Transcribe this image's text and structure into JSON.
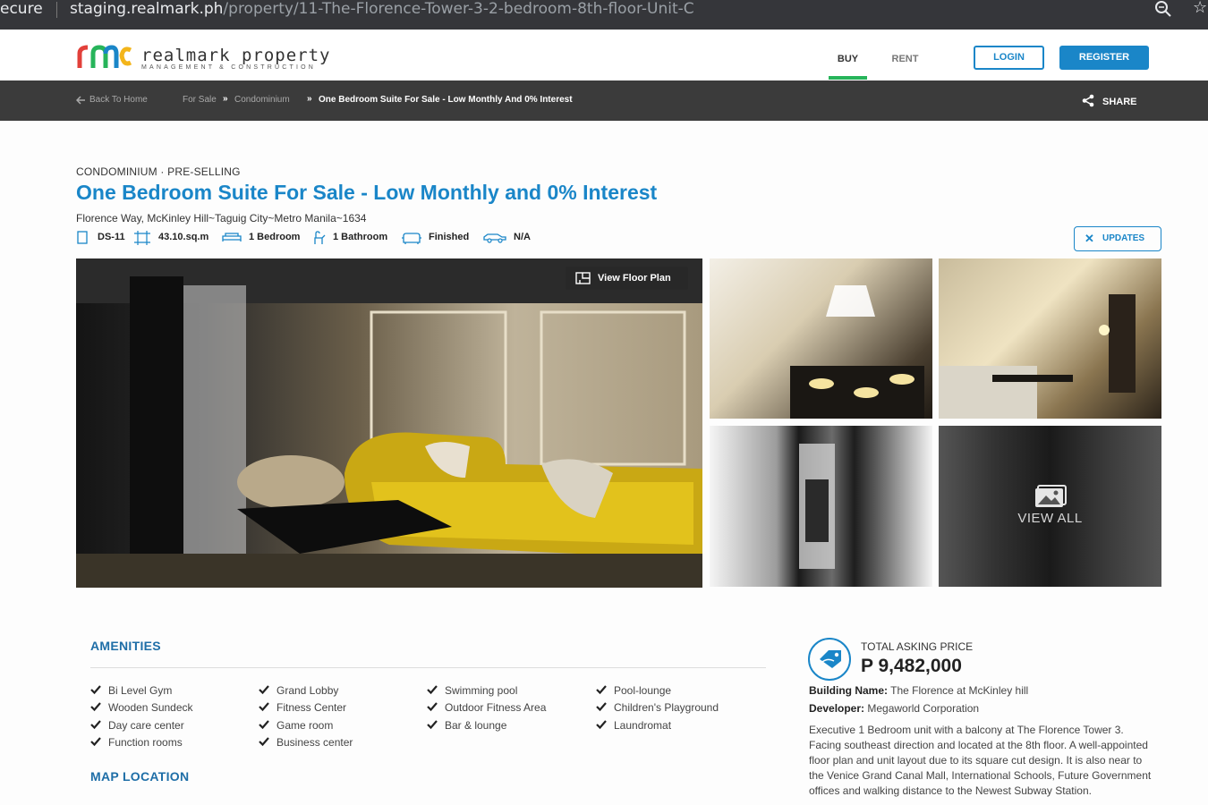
{
  "browser": {
    "security": "ecure",
    "url_host": "staging.realmark.ph",
    "url_path": "/property/11-The-Florence-Tower-3-2-bedroom-8th-floor-Unit-C"
  },
  "header": {
    "brand": "realmark property",
    "tagline": "MANAGEMENT & CONSTRUCTION",
    "nav_buy": "BUY",
    "nav_rent": "RENT",
    "login": "LOGIN",
    "register": "REGISTER",
    "colors": {
      "accent": "#1a86c8",
      "active_tab": "#27b45a"
    }
  },
  "breadcrumb": {
    "back": "Back To Home",
    "for_sale": "For Sale",
    "condominium": "Condominium",
    "current": "One Bedroom Suite For Sale - Low Monthly And 0% Interest",
    "share": "SHARE"
  },
  "listing": {
    "category": "CONDOMINIUM · PRE-SELLING",
    "title": "One Bedroom Suite For Sale - Low Monthly and 0% Interest",
    "address": "Florence Way, McKinley Hill~Taguig City~Metro Manila~1634",
    "specs": {
      "unit": "DS-11",
      "area": "43.10.sq.m",
      "bedroom": "1 Bedroom",
      "bathroom": "1 Bathroom",
      "finish": "Finished",
      "parking": "N/A"
    },
    "updates": "UPDATES",
    "floor_plan": "View Floor Plan",
    "view_all": "VIEW ALL"
  },
  "amenities": {
    "heading": "AMENITIES",
    "columns": [
      [
        "Bi Level Gym",
        "Wooden Sundeck",
        "Day care center",
        "Function rooms"
      ],
      [
        "Grand Lobby",
        "Fitness Center",
        "Game room",
        "Business center"
      ],
      [
        "Swimming pool",
        "Outdoor Fitness Area",
        "Bar & lounge"
      ],
      [
        "Pool-lounge",
        "Children's Playground",
        "Laundromat"
      ]
    ]
  },
  "map": {
    "heading": "MAP LOCATION"
  },
  "price": {
    "label": "TOTAL ASKING PRICE",
    "value": "P 9,482,000",
    "building_label": "Building Name:",
    "building": "The Florence at McKinley hill",
    "developer_label": "Developer:",
    "developer": "Megaworld Corporation",
    "description": "Executive 1 Bedroom unit with a balcony at The Florence Tower 3. Facing southeast direction and located at the 8th floor. A well-appointed floor plan and unit layout due to its square cut design. It is also near to the Venice Grand Canal Mall, International Schools, Future Government offices and walking distance to the Newest Subway Station."
  }
}
